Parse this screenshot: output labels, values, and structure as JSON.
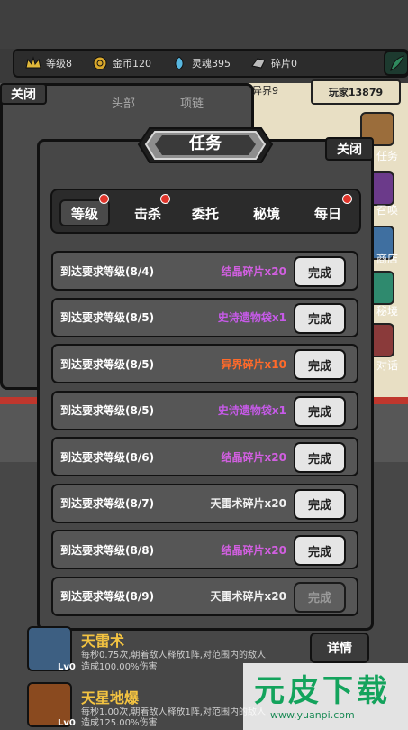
{
  "resources": [
    {
      "icon": "crown-icon",
      "label": "等级8",
      "color": "#e0b83a"
    },
    {
      "icon": "coin-icon",
      "label": "金币120",
      "color": "#e0b83a"
    },
    {
      "icon": "soul-icon",
      "label": "灵魂395",
      "color": "#58b7e0"
    },
    {
      "icon": "fragment-icon",
      "label": "碎片0",
      "color": "#bbbbbb"
    }
  ],
  "background": {
    "close_label": "关闭",
    "tab_head": "头部",
    "tab_necklace": "项链",
    "world_label": "异界9",
    "player_label": "玩家13879",
    "side_menu": [
      "任务",
      "召唤",
      "商店",
      "秘境",
      "对话"
    ]
  },
  "dialog": {
    "title": "任务",
    "close_label": "关闭",
    "tabs": [
      {
        "label": "等级",
        "active": true,
        "dot": true
      },
      {
        "label": "击杀",
        "active": false,
        "dot": true
      },
      {
        "label": "委托",
        "active": false,
        "dot": false
      },
      {
        "label": "秘境",
        "active": false,
        "dot": false
      },
      {
        "label": "每日",
        "active": false,
        "dot": true
      }
    ],
    "quests": [
      {
        "label": "到达要求等级(8/4)",
        "reward": "结晶碎片x20",
        "reward_color": "#d15fe0",
        "button": "完成",
        "enabled": true
      },
      {
        "label": "到达要求等级(8/5)",
        "reward": "史诗遗物袋x1",
        "reward_color": "#c65ae8",
        "button": "完成",
        "enabled": true
      },
      {
        "label": "到达要求等级(8/5)",
        "reward": "异界碎片x10",
        "reward_color": "#ff6a2a",
        "button": "完成",
        "enabled": true
      },
      {
        "label": "到达要求等级(8/5)",
        "reward": "史诗遗物袋x1",
        "reward_color": "#c65ae8",
        "button": "完成",
        "enabled": true
      },
      {
        "label": "到达要求等级(8/6)",
        "reward": "结晶碎片x20",
        "reward_color": "#d15fe0",
        "button": "完成",
        "enabled": true
      },
      {
        "label": "到达要求等级(8/7)",
        "reward": "天雷术碎片x20",
        "reward_color": "#f0f0f0",
        "button": "完成",
        "enabled": true
      },
      {
        "label": "到达要求等级(8/8)",
        "reward": "结晶碎片x20",
        "reward_color": "#d15fe0",
        "button": "完成",
        "enabled": true
      },
      {
        "label": "到达要求等级(8/9)",
        "reward": "天雷术碎片x20",
        "reward_color": "#f0f0f0",
        "button": "完成",
        "enabled": false
      }
    ]
  },
  "skills": [
    {
      "name": "天雷术",
      "level": "Lv0",
      "desc1": "每秒0.75次,朝着敌人释放1阵,对范围内的敌人",
      "desc2": "造成100.00%伤害"
    },
    {
      "name": "天星地爆",
      "level": "Lv0",
      "desc1": "每秒1.00次,朝着敌人释放1阵,对范围内的敌人",
      "desc2": "造成125.00%伤害"
    }
  ],
  "detail_label": "详情",
  "watermark": {
    "title": "元皮下载",
    "url": "www.yuanpi.com"
  }
}
